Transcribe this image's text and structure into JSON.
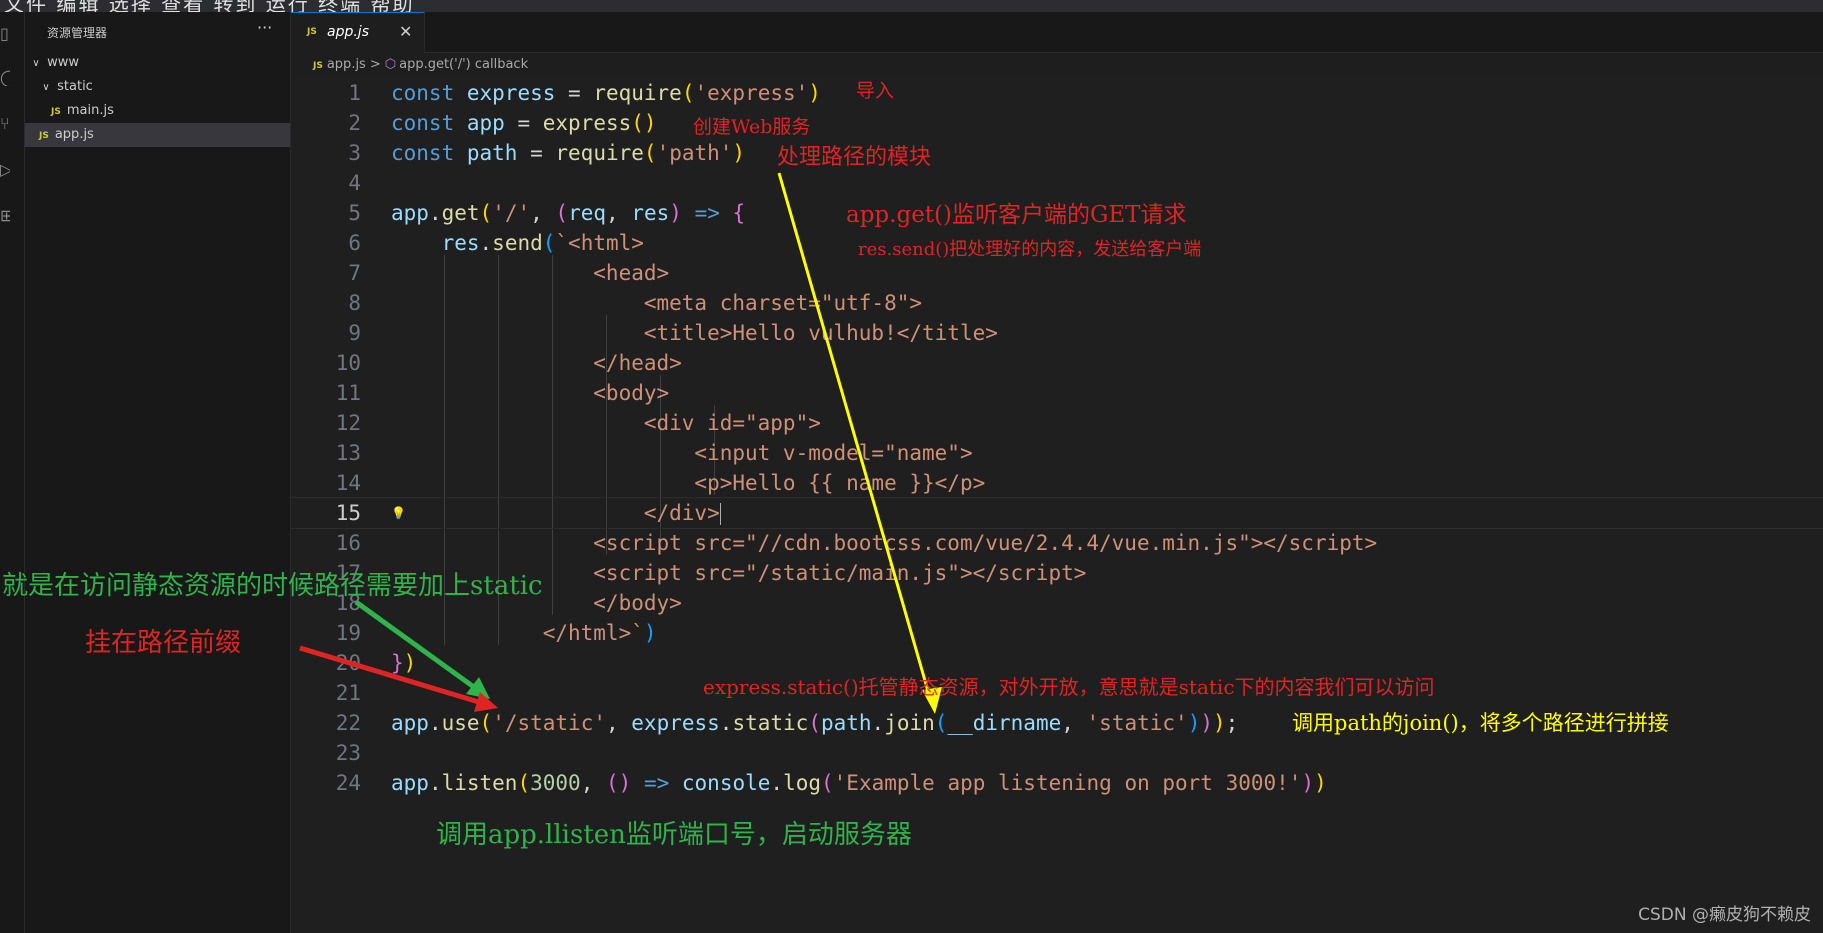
{
  "colors": {
    "red": "#e02424",
    "yellow": "#ffff00",
    "green": "#2fb34a",
    "white": "#ffffff"
  },
  "menubar": {
    "items": "文件  编辑  选择  查看  转到  运行  终端  帮助"
  },
  "explorer": {
    "title": "资源管理器",
    "more": "···",
    "tree": [
      {
        "label": "www",
        "chevron": "∨"
      },
      {
        "label": "static",
        "chevron": "∨"
      },
      {
        "label": "main.js",
        "badge": "JS"
      },
      {
        "label": "app.js",
        "badge": "JS"
      }
    ]
  },
  "tab": {
    "name": "app.js",
    "badge": "JS",
    "close": "✕"
  },
  "breadcrumb": {
    "file": "app.js",
    "badge": "JS",
    "separator": ">",
    "symbol": "app.get('/') callback"
  },
  "editor": {
    "current_line": 15,
    "lines": [
      {
        "n": "1"
      },
      {
        "n": "2"
      },
      {
        "n": "3"
      },
      {
        "n": "4"
      },
      {
        "n": "5"
      },
      {
        "n": "6"
      },
      {
        "n": "7"
      },
      {
        "n": "8"
      },
      {
        "n": "9"
      },
      {
        "n": "10"
      },
      {
        "n": "11"
      },
      {
        "n": "12"
      },
      {
        "n": "13"
      },
      {
        "n": "14"
      },
      {
        "n": "15"
      },
      {
        "n": "16"
      },
      {
        "n": "17"
      },
      {
        "n": "18"
      },
      {
        "n": "19"
      },
      {
        "n": "20"
      },
      {
        "n": "21"
      },
      {
        "n": "22"
      },
      {
        "n": "23"
      },
      {
        "n": "24"
      }
    ]
  },
  "annotations": {
    "import": "导入",
    "create_web": "创建Web服务",
    "path_module": "处理路径的模块",
    "app_get": "app.get()监听客户端的GET请求",
    "res_send": "res.send()把处理好的内容，发送给客户端",
    "static_desc": "express.static()托管静态资源，对外开放，意思就是static下的内容我们可以访问",
    "path_join": "调用path的join()，将多个路径进行拼接",
    "static_prefix": "就是在访问静态资源的时候路径需要加上static",
    "prefix": "挂在路径前缀",
    "listen": "调用app.llisten监听端口号，启动服务器"
  },
  "watermark": "CSDN @癞皮狗不赖皮"
}
